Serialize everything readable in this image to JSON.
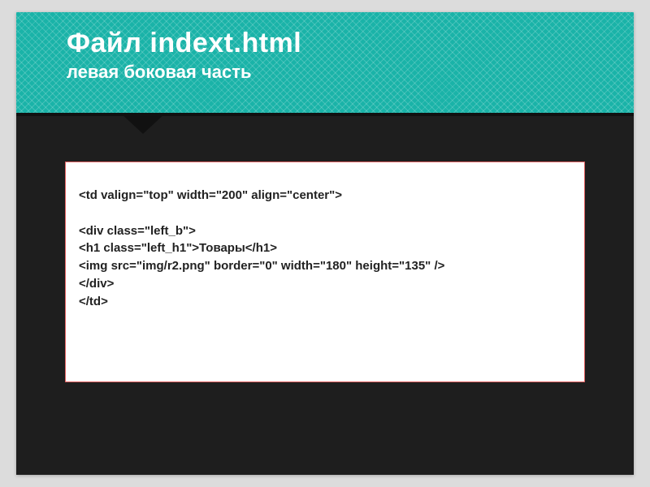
{
  "header": {
    "title": "Файл indext.html",
    "subtitle": "левая боковая часть"
  },
  "code": {
    "lines": [
      "<td valign=\"top\" width=\"200\" align=\"center\">",
      "",
      "<div class=\"left_b\">",
      "<h1 class=\"left_h1\">Товары</h1>",
      "<img src=\"img/r2.png\" border=\"0\" width=\"180\" height=\"135\" />",
      "</div>",
      "</td>"
    ]
  }
}
